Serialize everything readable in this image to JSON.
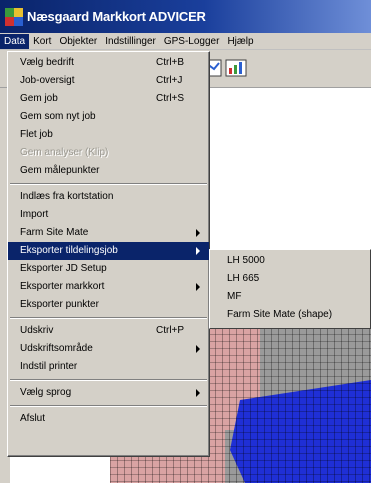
{
  "window": {
    "title": "Næsgaard Markkort ADVICER"
  },
  "menubar": {
    "items": [
      {
        "label": "Data",
        "active": true
      },
      {
        "label": "Kort"
      },
      {
        "label": "Objekter"
      },
      {
        "label": "Indstillinger"
      },
      {
        "label": "GPS-Logger"
      },
      {
        "label": "Hjælp"
      }
    ]
  },
  "data_menu": {
    "items": [
      {
        "label": "Vælg bedrift",
        "shortcut": "Ctrl+B"
      },
      {
        "label": "Job-oversigt",
        "shortcut": "Ctrl+J"
      },
      {
        "label": "Gem job",
        "shortcut": "Ctrl+S"
      },
      {
        "label": "Gem som nyt job"
      },
      {
        "label": "Flet job"
      },
      {
        "label": "Gem analyser (Klip)",
        "disabled": true
      },
      {
        "label": "Gem målepunkter"
      },
      {
        "label": "Indlæs fra kortstation"
      },
      {
        "label": "Import"
      },
      {
        "label": "Farm Site Mate",
        "submenu": true
      },
      {
        "label": "Eksporter tildelingsjob",
        "submenu": true,
        "selected": true
      },
      {
        "label": "Eksporter JD Setup"
      },
      {
        "label": "Eksporter markkort",
        "submenu": true
      },
      {
        "label": "Eksporter punkter"
      },
      {
        "label": "Udskriv",
        "shortcut": "Ctrl+P"
      },
      {
        "label": "Udskriftsområde",
        "submenu": true
      },
      {
        "label": "Indstil printer"
      },
      {
        "label": "Vælg sprog",
        "submenu": true
      },
      {
        "label": "Afslut"
      }
    ]
  },
  "export_submenu": {
    "items": [
      {
        "label": "LH 5000"
      },
      {
        "label": "LH 665"
      },
      {
        "label": "MF"
      },
      {
        "label": "Farm Site Mate (shape)"
      }
    ]
  },
  "colors": {
    "title_start": "#0a246a",
    "title_end": "#6f8fd8",
    "menu_bg": "#d4d0c8",
    "highlight": "#0a246a",
    "map_pink": "#d9a3a3",
    "map_blue": "#1f2fd6",
    "map_gray": "#9a9a9a"
  },
  "icons": {
    "app": "application-map-icon",
    "toolbar_right": "chart-icon"
  }
}
